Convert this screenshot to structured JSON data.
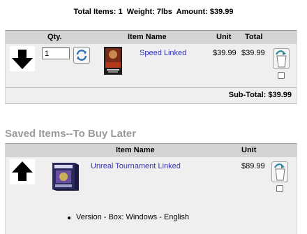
{
  "summary": {
    "text": "Total Items: 1  Weight: 7lbs  Amount: $39.99"
  },
  "cart": {
    "headers": {
      "qty": "Qty.",
      "item_name": "Item Name",
      "unit": "Unit",
      "total": "Total"
    },
    "items": [
      {
        "quantity": "1",
        "name": "Speed Linked",
        "unit": "$39.99",
        "total": "$39.99",
        "move_icon": "arrow-down-icon",
        "refresh_icon": "refresh-icon",
        "remove_icon": "trash-icon"
      }
    ],
    "subtotal": "Sub-Total: $39.99"
  },
  "saved": {
    "title": "Saved Items--To Buy Later",
    "headers": {
      "item_name": "Item Name",
      "unit": "Unit"
    },
    "items": [
      {
        "name": "Unreal Tournament Linked",
        "unit": "$89.99",
        "move_icon": "arrow-up-icon",
        "remove_icon": "trash-icon",
        "options": [
          "Version - Box: Windows - English"
        ]
      }
    ]
  },
  "colors": {
    "header_bg": "#d4d4d4",
    "row_bg": "#efefef",
    "link": "#3333bb",
    "saved_title": "#9a9a9a",
    "trash_teal": "#2e8b9e"
  }
}
